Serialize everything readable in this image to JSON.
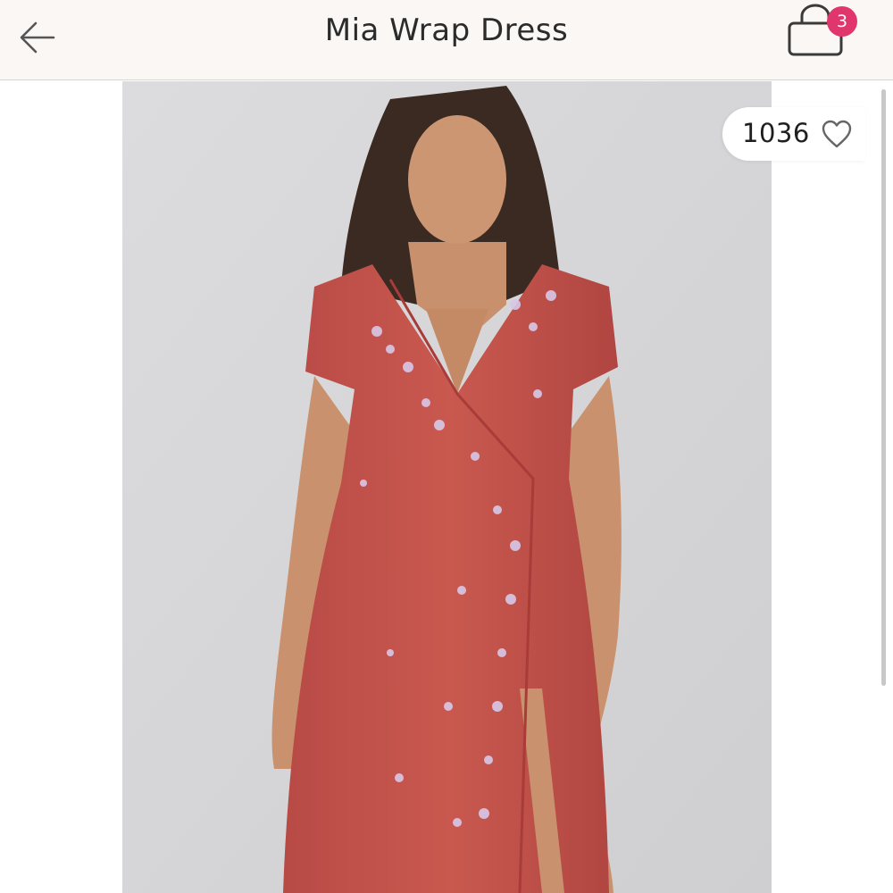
{
  "header": {
    "title": "Mia Wrap Dress",
    "back_icon": "arrow-left-icon",
    "cart_icon": "shopping-bag-icon",
    "cart_count": "3",
    "badge_color": "#e0356d"
  },
  "product": {
    "like_count": "1036",
    "heart_icon": "heart-outline-icon",
    "image": "model wearing red embroidered wrap dress"
  },
  "colors": {
    "header_bg": "#faf7f4",
    "dress": "#c4544f",
    "photo_bg": "#d6d6d8"
  }
}
